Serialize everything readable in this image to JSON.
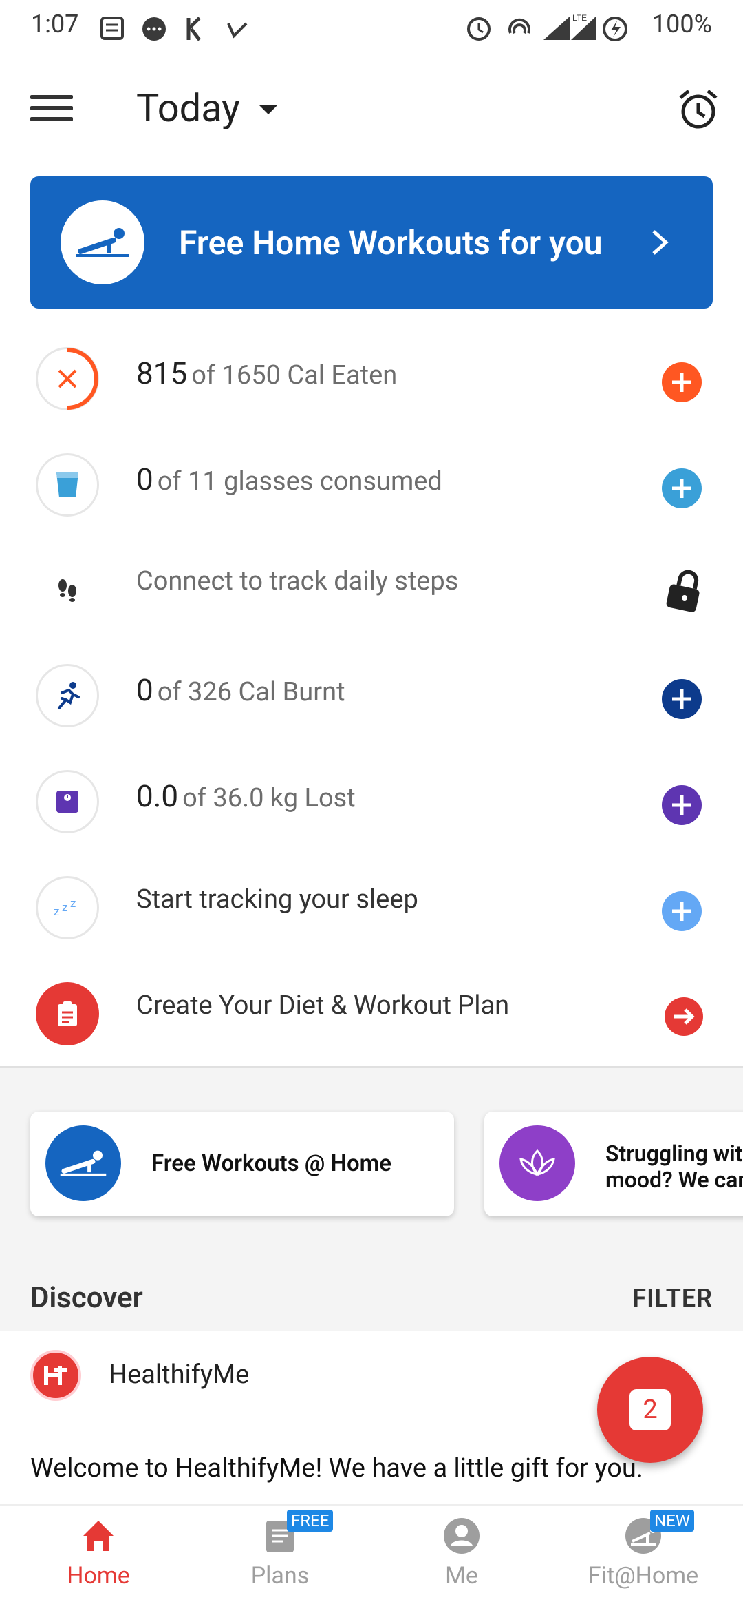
{
  "status_bar": {
    "time": "1:07",
    "battery": "100%"
  },
  "app_bar": {
    "title": "Today"
  },
  "banner": {
    "text": "Free Home Workouts for you"
  },
  "trackers": [
    {
      "num": "815",
      "rest": "of 1650 Cal Eaten",
      "accent": "#ff5722"
    },
    {
      "num": "0",
      "rest": "of 11 glasses consumed",
      "accent": "#3aa0d8"
    },
    {
      "num": "",
      "rest": "Connect to track daily steps",
      "accent": "#222222"
    },
    {
      "num": "0",
      "rest": "of 326 Cal Burnt",
      "accent": "#0d3b8c"
    },
    {
      "num": "0.0",
      "rest": "of 36.0 kg Lost",
      "accent": "#5e35b1"
    },
    {
      "num": "",
      "rest": "Start tracking your sleep",
      "accent": "#64a8f5"
    },
    {
      "num": "",
      "rest": "Create Your Diet & Workout Plan",
      "accent": "#e53935"
    }
  ],
  "cards": [
    {
      "title": "Free Workouts @ Home"
    },
    {
      "title": "Struggling with mood? We can"
    }
  ],
  "discover": {
    "title": "Discover",
    "filter": "FILTER"
  },
  "feed": {
    "author": "HealthifyMe",
    "text": "Welcome to HealthifyMe! We have a little gift for you.",
    "fab_count": "2"
  },
  "bottom_nav": [
    {
      "label": "Home"
    },
    {
      "label": "Plans",
      "badge": "FREE"
    },
    {
      "label": "Me"
    },
    {
      "label": "Fit@Home",
      "badge": "NEW"
    }
  ]
}
